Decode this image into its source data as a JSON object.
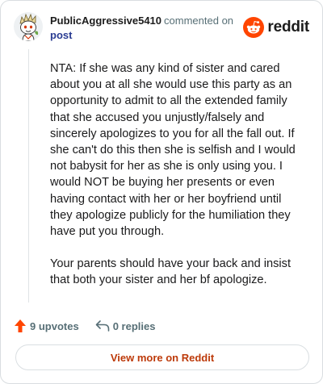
{
  "header": {
    "username": "PublicAggressive5410",
    "commented_text": "commented on",
    "post_link": "post",
    "brand_wordmark": "reddit"
  },
  "comment": {
    "paragraphs": [
      "NTA: If she was any kind of sister and cared about you at all she would use this party as an opportunity to admit to all the extended family that she accused you unjustly/falsely and sincerely apologizes to you for all the fall out. If she can't do this then she is selfish and I would not babysit for her as she is only using you. I would NOT be buying her presents or even having contact with her or her boyfriend until they apologize publicly for the humiliation they have put you through.",
      "Your parents should have your back and insist that both your sister and her bf apologize."
    ]
  },
  "actions": {
    "upvotes": "9 upvotes",
    "replies": "0 replies"
  },
  "view_more_label": "View more on Reddit",
  "colors": {
    "brand": "#ff4500",
    "upvote": "#ff4500",
    "link": "#2a3c92",
    "view_more": "#bd3a0a",
    "muted": "#576f76"
  },
  "icons": {
    "avatar": "snoo-avatar",
    "brand": "reddit-logo-icon",
    "upvote": "upvote-arrow-icon",
    "reply": "reply-arrow-icon"
  }
}
